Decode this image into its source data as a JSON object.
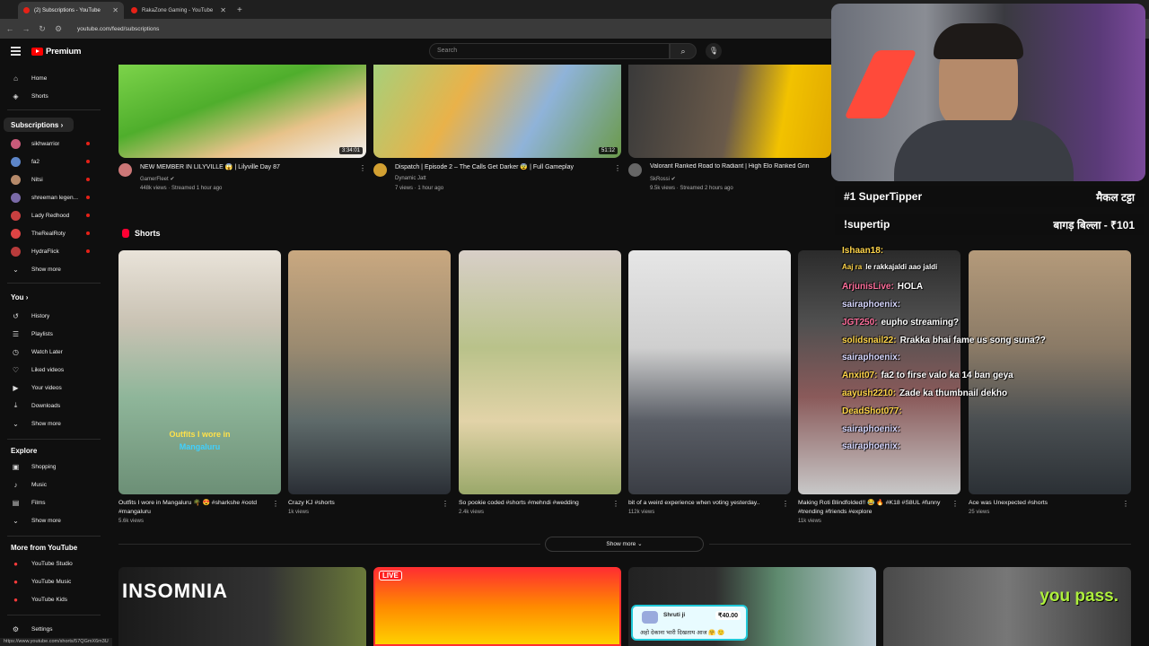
{
  "browser": {
    "tabs": [
      {
        "label": "(2) Subscriptions - YouTube",
        "active": true
      },
      {
        "label": "RakaZone Gaming - YouTube",
        "active": false
      }
    ],
    "url": "youtube.com/feed/subscriptions",
    "status_url": "https://www.youtube.com/shorts/57QGmX6m3U"
  },
  "header": {
    "logo_text": "Premium",
    "search_placeholder": "Search"
  },
  "sidebar": {
    "top": [
      {
        "label": "Home",
        "icon": "home-icon",
        "glyph": "⌂"
      },
      {
        "label": "Shorts",
        "icon": "shorts-icon",
        "glyph": "◈"
      }
    ],
    "subscriptions_heading": "Subscriptions",
    "subscriptions": [
      {
        "label": "sikhwarrior",
        "color": "#c95b7a"
      },
      {
        "label": "fa2",
        "color": "#5d86c9"
      },
      {
        "label": "Nitsi",
        "color": "#b68a6a"
      },
      {
        "label": "shreeman legen...",
        "color": "#7a6aa8"
      },
      {
        "label": "Lady Redhood",
        "color": "#c94040"
      },
      {
        "label": "TheRealRoty",
        "color": "#d44"
      },
      {
        "label": "HydraFlick",
        "color": "#b83b3b"
      }
    ],
    "show_more_1": "Show more",
    "you_heading": "You",
    "you": [
      {
        "label": "History",
        "icon": "history-icon",
        "glyph": "↺"
      },
      {
        "label": "Playlists",
        "icon": "playlists-icon",
        "glyph": "☰"
      },
      {
        "label": "Watch Later",
        "icon": "watch-later-icon",
        "glyph": "◷"
      },
      {
        "label": "Liked videos",
        "icon": "like-icon",
        "glyph": "👍"
      },
      {
        "label": "Your videos",
        "icon": "your-videos-icon",
        "glyph": "▶"
      },
      {
        "label": "Downloads",
        "icon": "download-icon",
        "glyph": "⤓"
      }
    ],
    "show_more_2": "Show more",
    "explore_heading": "Explore",
    "explore": [
      {
        "label": "Shopping",
        "icon": "shopping-icon",
        "glyph": "🛍"
      },
      {
        "label": "Music",
        "icon": "music-icon",
        "glyph": "♪"
      },
      {
        "label": "Films",
        "icon": "films-icon",
        "glyph": "🎞"
      }
    ],
    "show_more_3": "Show more",
    "more_heading": "More from YouTube",
    "more": [
      {
        "label": "YouTube Studio"
      },
      {
        "label": "YouTube Music"
      },
      {
        "label": "YouTube Kids"
      }
    ],
    "settings": "Settings"
  },
  "videos": [
    {
      "title": "NEW MEMBER IN LILYVILLE 😱 | Lilyville Day 87",
      "channel": "GamerFleet ✔",
      "stats": "448k views · Streamed 1 hour ago",
      "duration": "3:34:01",
      "avatar_color": "#c77"
    },
    {
      "title": "Dispatch | Episode 2 – The Calls Get Darker 😨 | Full Gameplay",
      "channel": "Dynamic Jatt",
      "stats": "7 views · 1 hour ago",
      "duration": "51:12",
      "avatar_color": "#d2a032"
    },
    {
      "title": "Valorant Ranked Road to Radiant | High Elo Ranked Grin",
      "channel": "SkRossi ✔",
      "stats": "9.5k views · Streamed 2 hours ago",
      "duration": "",
      "avatar_color": "#666"
    }
  ],
  "shorts_heading": "Shorts",
  "shorts": [
    {
      "title": "Outfits I wore in Mangaluru 🌴 😍 #sharkshe #ootd #mangaluru",
      "views": "5.6k views",
      "caption_line1": "Outfits I wore in",
      "caption_line2": "Mangaluru"
    },
    {
      "title": "Crazy KJ #shorts",
      "views": "1k views"
    },
    {
      "title": "So pookie coded #shorts #mehndi #wedding",
      "views": "2.4k views"
    },
    {
      "title": "bit of a weird experience when voting yesterday..",
      "views": "112k views"
    },
    {
      "title": "Making Roti Blindfolded!! 😂 🔥 #K18 #S8UL #funny #trending #friends #explore",
      "views": "11k views"
    },
    {
      "title": "Ace was Unexpected #shorts",
      "views": "25 views"
    }
  ],
  "show_more_label": "Show more",
  "bottom_thumbs": [
    {
      "text": "INSOMNIA"
    },
    {
      "text": "LIVE"
    },
    {
      "text": ""
    },
    {
      "text": "you pass."
    }
  ],
  "overlay": {
    "tip_rows": [
      {
        "left": "#1 SuperTipper",
        "right": "मैकल टट्टा"
      },
      {
        "left": "!supertip",
        "right": "बागड़ बिल्ला - ₹101"
      }
    ],
    "chat": [
      {
        "user": "Ishaan18:",
        "msg": "",
        "color": "yel"
      },
      {
        "user": "Aaj ra",
        "msg": "le rakkajaldi aao jaldi",
        "color": "yel"
      },
      {
        "user": "ArjunisLive:",
        "msg": "HOLA",
        "color": "pink"
      },
      {
        "user": "sairaphoenix:",
        "msg": "",
        "color": ""
      },
      {
        "user": "JGT250:",
        "msg": "eupho streaming?",
        "color": "pink"
      },
      {
        "user": "solidsnail22:",
        "msg": "Rrakka bhai fame us song suna??",
        "color": "yel"
      },
      {
        "user": "sairaphoenix:",
        "msg": "",
        "color": ""
      },
      {
        "user": "Anxit07:",
        "msg": "fa2 to firse valo ka 14 ban geya",
        "color": "yel"
      },
      {
        "user": "aayush2210:",
        "msg": "Zade ka thumbnail dekho",
        "color": "yel"
      },
      {
        "user": "DeadShot077:",
        "msg": "",
        "color": "yel"
      },
      {
        "user": "sairaphoenix:",
        "msg": "",
        "color": ""
      },
      {
        "user": "sairaphoenix:",
        "msg": "",
        "color": ""
      }
    ],
    "donation": {
      "name": "Shruti ji",
      "amount": "₹40.00",
      "message": "अहो देकाना भारी दिखताय आज 🤗 🙂"
    }
  }
}
